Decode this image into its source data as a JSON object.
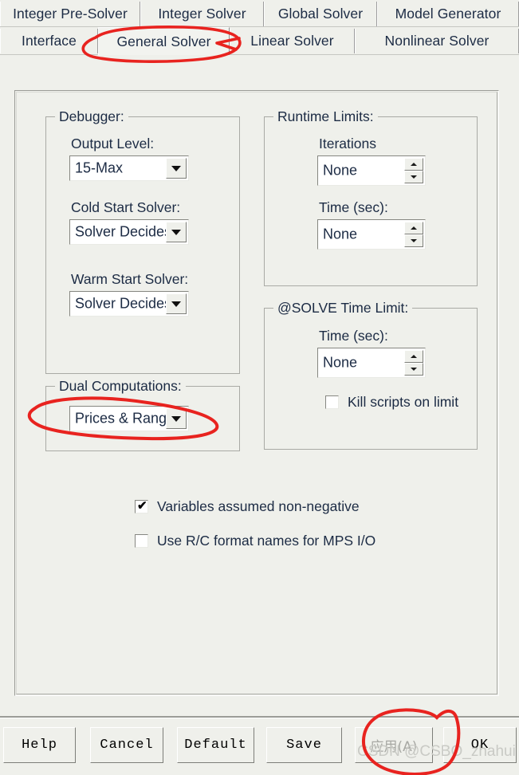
{
  "window": {
    "title": "General Solver"
  },
  "tabs": {
    "row1": [
      {
        "label": "Integer Pre-Solver",
        "selected": false
      },
      {
        "label": "Integer Solver",
        "selected": false
      },
      {
        "label": "Global Solver",
        "selected": false
      },
      {
        "label": "Model Generator",
        "selected": false
      }
    ],
    "row2": [
      {
        "label": "Interface",
        "selected": false
      },
      {
        "label": "General Solver",
        "selected": true
      },
      {
        "label": "Linear Solver",
        "selected": false
      },
      {
        "label": "Nonlinear Solver",
        "selected": false
      }
    ]
  },
  "debugger": {
    "title": "Debugger:",
    "output_level": {
      "label": "Output Level:",
      "value": "15-Max",
      "icon": "chevron-down-icon"
    },
    "cold_start_solver": {
      "label": "Cold Start Solver:",
      "value": "Solver Decides",
      "icon": "chevron-down-icon"
    },
    "warm_start_solver": {
      "label": "Warm Start Solver:",
      "value": "Solver Decides",
      "icon": "chevron-down-icon"
    }
  },
  "dual_computations": {
    "title": "Dual Computations:",
    "value": "Prices & Ranges",
    "icon": "chevron-down-icon"
  },
  "runtime_limits": {
    "title": "Runtime Limits:",
    "iterations": {
      "label": "Iterations",
      "value": "None"
    },
    "time": {
      "label": "Time (sec):",
      "value": "None"
    }
  },
  "solve_time_limit": {
    "title": "@SOLVE Time Limit:",
    "time": {
      "label": "Time (sec):",
      "value": "None"
    },
    "kill_scripts": {
      "label": "Kill scripts on limit",
      "checked": false
    }
  },
  "options": {
    "non_negative": {
      "label": "Variables assumed non-negative",
      "checked": true,
      "mark": "✔"
    },
    "rc_format": {
      "label": "Use R/C format names for MPS I/O",
      "checked": false,
      "mark": ""
    }
  },
  "buttons": [
    {
      "label": "Help",
      "disabled": false
    },
    {
      "label": "Cancel",
      "disabled": false
    },
    {
      "label": "Default",
      "disabled": false
    },
    {
      "label": "Save",
      "disabled": false
    },
    {
      "label": "应用(A)",
      "disabled": true
    },
    {
      "label": "OK",
      "disabled": false
    }
  ],
  "watermark": {
    "text": "CSDN @CSBO_zhahui"
  },
  "annotation": {
    "color": "#e8231f",
    "shapes": "ellipse-general-solver-tab, ellipse-prices-and-ranges, ellipse-apply-button"
  }
}
